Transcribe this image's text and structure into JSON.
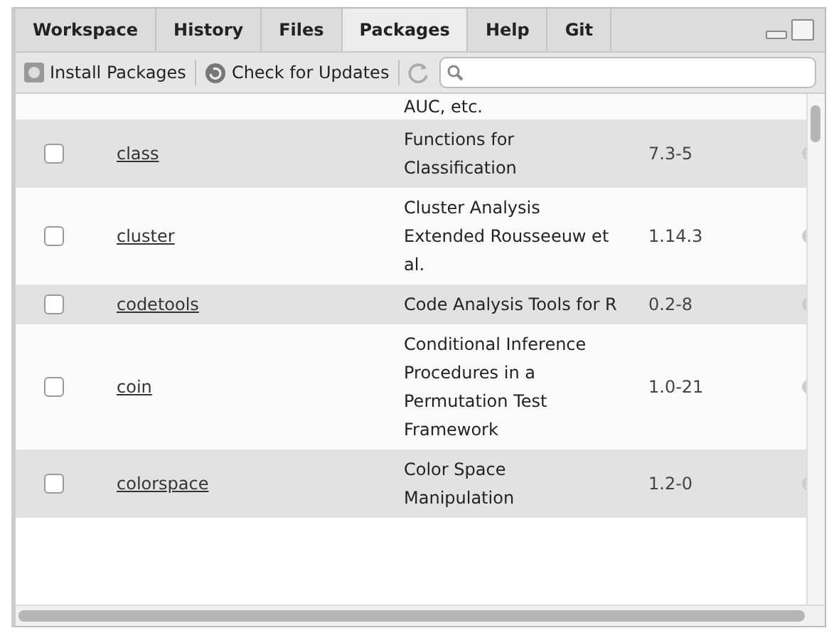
{
  "tabs": [
    {
      "label": "Workspace",
      "selected": false
    },
    {
      "label": "History",
      "selected": false
    },
    {
      "label": "Files",
      "selected": false
    },
    {
      "label": "Packages",
      "selected": true
    },
    {
      "label": "Help",
      "selected": false
    },
    {
      "label": "Git",
      "selected": false
    }
  ],
  "toolbar": {
    "install": "Install Packages",
    "check": "Check for Updates"
  },
  "cut_top_description": "AUC, etc.",
  "packages": [
    {
      "name": "class",
      "description": "Functions for Classification",
      "version": "7.3-5",
      "loaded": false
    },
    {
      "name": "cluster",
      "description": "Cluster Analysis Extended Rousseeuw et al.",
      "version": "1.14.3",
      "loaded": false
    },
    {
      "name": "codetools",
      "description": "Code Analysis Tools for R",
      "version": "0.2-8",
      "loaded": false
    },
    {
      "name": "coin",
      "description": "Conditional Inference Procedures in a Permutation Test Framework",
      "version": "1.0-21",
      "loaded": false
    },
    {
      "name": "colorspace",
      "description": "Color Space Manipulation",
      "version": "1.2-0",
      "loaded": false
    }
  ]
}
